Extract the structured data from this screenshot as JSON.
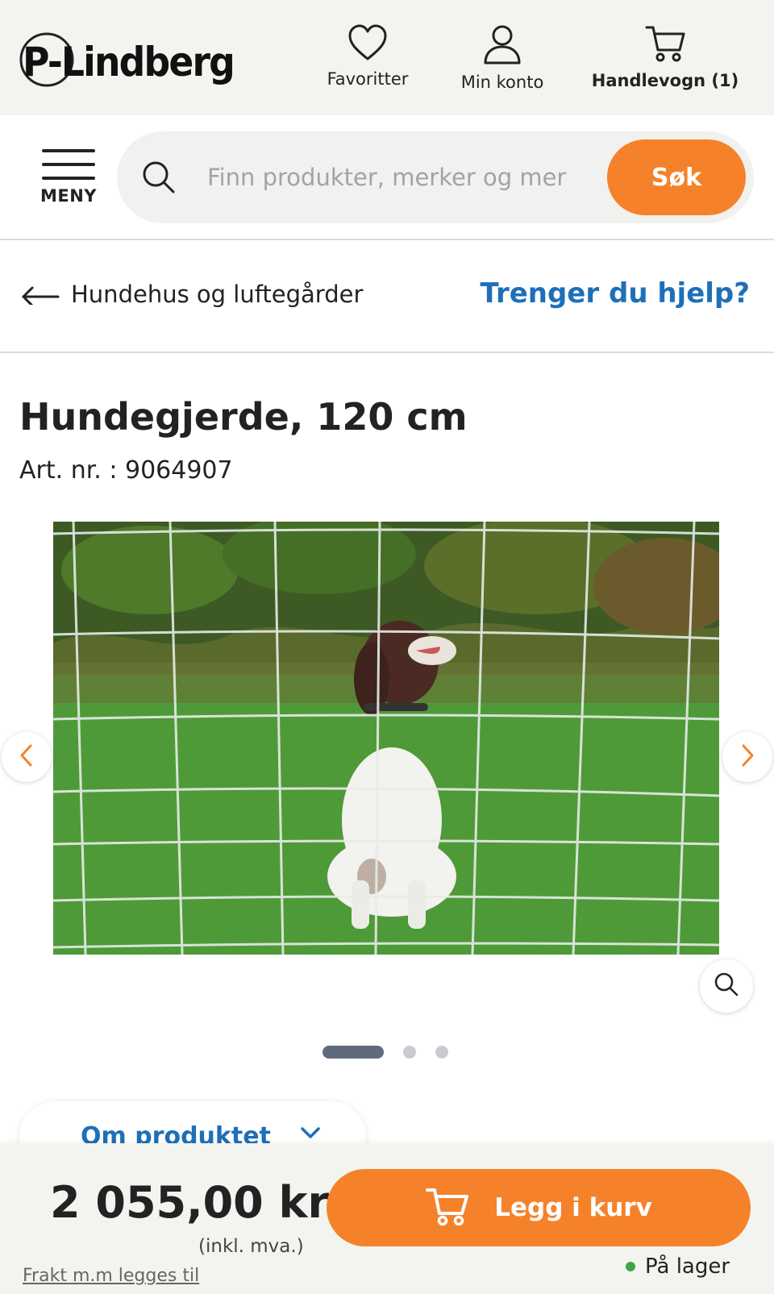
{
  "header": {
    "logo_text": "P-Lindberg",
    "favorites_label": "Favoritter",
    "account_label": "Min konto",
    "cart_label": "Handlevogn (1)"
  },
  "search": {
    "menu_label": "MENY",
    "placeholder": "Finn produkter, merker og mer",
    "value": "",
    "button_label": "Søk"
  },
  "breadcrumb": {
    "back_label": "Hundehus og luftegårder",
    "help_label": "Trenger du hjelp?"
  },
  "product": {
    "title": "Hundegjerde, 120 cm",
    "article_number": "Art. nr. : 9064907",
    "image_description_icon": "product-photo",
    "carousel": {
      "total_images": 3,
      "active_index": 0
    },
    "tab_label": "Om produktet"
  },
  "purchase": {
    "price": "2 055,00 kr",
    "vat_note": "(inkl. mva.)",
    "shipping_note": "Frakt m.m legges til",
    "add_to_cart_label": "Legg i kurv",
    "stock_status": "På lager"
  },
  "colors": {
    "accent_orange": "#f5822a",
    "link_blue": "#1e6fb8",
    "header_bg": "#f3f4ef",
    "in_stock_green": "#3aa745"
  }
}
